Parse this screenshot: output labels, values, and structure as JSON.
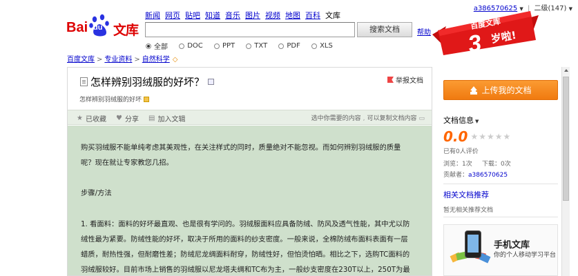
{
  "userbar": {
    "username": "a386570625",
    "level": "二级(147)"
  },
  "logo": {
    "part1": "Bai",
    "paw_text": "du",
    "part2": "文库"
  },
  "nav": {
    "items": [
      "新闻",
      "网页",
      "贴吧",
      "知道",
      "音乐",
      "图片",
      "视频",
      "地图",
      "百科"
    ],
    "current": "文库"
  },
  "search": {
    "value": "",
    "button": "搜索文档",
    "help": "帮助"
  },
  "filters": {
    "options": [
      "全部",
      "DOC",
      "PPT",
      "TXT",
      "PDF",
      "XLS"
    ],
    "selected": "全部"
  },
  "banner": {
    "text": "百度文库",
    "years": "3",
    "suffix": "岁啦!"
  },
  "breadcrumb": {
    "items": [
      "百度文库",
      "专业资料",
      "自然科学"
    ]
  },
  "doc": {
    "title": "怎样辨别羽绒服的好坏？",
    "report": "举报文档",
    "subtitle": "怎样辨别羽绒服的好坏",
    "toolbar": {
      "favorite": "已收藏",
      "share": "分享",
      "add_album": "加入文辑"
    },
    "toolbar_hint": {
      "a": "选中你需要的内容",
      "b": "可以复制文档内容"
    },
    "paragraphs": [
      "购买羽绒服不能单纯考虑其美观性，在关注样式的同时，质量绝对不能忽视。而如何辨别羽绒服的质量",
      "呢？现在就让专家教您几招。",
      "步骤/方法",
      "1. 看面料：面料的好坏最直观、也是很有学问的。羽绒服面料应具备防绒、防风及透气性能，其中尤以防",
      "绒性最为紧要。防绒性能的好坏，取决于所用的面料的纱支密度。一般来说，全棉防绒布面料表面有一层",
      "蜡质，耐热性强，但耐磨性差；防绒尼龙绸面料耐穿，防绒性好，但怕烫怕晒。相比之下，选购TC面料的",
      "羽绒服较好。目前市场上销售的羽绒服以尼龙塔夫绸和TC布为主，一般纱支密度在230T以上，250T为最"
    ]
  },
  "doc_info": {
    "heading": "文档信息",
    "score": "0.0",
    "raters": "已有0人评价",
    "views": "浏览：1次",
    "downloads": "下载：0次",
    "contributor_label": "贡献者：",
    "contributor": "a386570625"
  },
  "related": {
    "heading": "相关文档推荐",
    "empty": "暂无相关推荐文档"
  },
  "mobile": {
    "title": "手机文库",
    "subtitle": "你的个人移动学习平台"
  },
  "upload_button": "上传我的文档"
}
